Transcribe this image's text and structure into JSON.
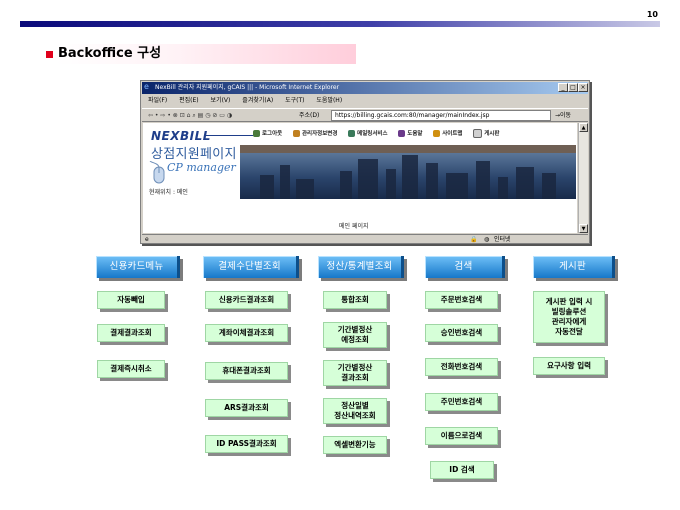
{
  "page": {
    "number": "10",
    "title": "Backoffice 구성"
  },
  "browser": {
    "window_title": "NexBill 관리자 지원페이지, gCAIS ||| - Microsoft Internet Explorer",
    "menu": [
      "파일(F)",
      "편집(E)",
      "보기(V)",
      "즐겨찾기(A)",
      "도구(T)",
      "도움말(H)"
    ],
    "toolbar_icons": "⇦ • ⇨ • ⊗ ⊡ ⌂ ⌕ ▤ ◷ ⊘ ▭ ◑",
    "address_label": "주소(D)",
    "address": "https://billing.gcais.com:80/manager/mainIndex.jsp",
    "go_label": "이동",
    "status_zone": "인터넷"
  },
  "site": {
    "logo": "NEXBILL",
    "nav": [
      "로그아웃",
      "관리자정보변경",
      "메일링서비스",
      "도움말",
      "사이트맵",
      "게시판"
    ],
    "title": "상점지원페이지",
    "subtitle": "CP manager",
    "location": "현재위치 : 메인",
    "main_label": "메인 페이지"
  },
  "categories": [
    {
      "label": "신용카드메뉴",
      "items": [
        "자동빼입",
        "결제결과조회",
        "결제즉시취소"
      ]
    },
    {
      "label": "결제수단별조회",
      "items": [
        "신용카드결과조회",
        "계좌이체결과조회",
        "휴대폰결과조회",
        "ARS결과조회",
        "ID PASS결과조회"
      ]
    },
    {
      "label": "정산/통계별조회",
      "items": [
        "통합조회",
        "기간별정산\n예정조회",
        "기간별정산\n결과조회",
        "정산일별\n정산내역조회",
        "엑셀변환기능"
      ]
    },
    {
      "label": "검색",
      "items": [
        "주문번호검색",
        "승인번호검색",
        "전화번호검색",
        "주민번호검색",
        "이름으로검색",
        "ID 검색"
      ]
    },
    {
      "label": "게시판",
      "items": [
        "게시판 입력 시\n빌링솔루션\n관리자에게\n자동전달",
        "요구사항 입력"
      ]
    }
  ],
  "colors": {
    "accent_red": "#e0001b",
    "category_blue": "#1677c9",
    "item_green": "#d6ffd8",
    "titlebar_navy": "#0a246a"
  }
}
